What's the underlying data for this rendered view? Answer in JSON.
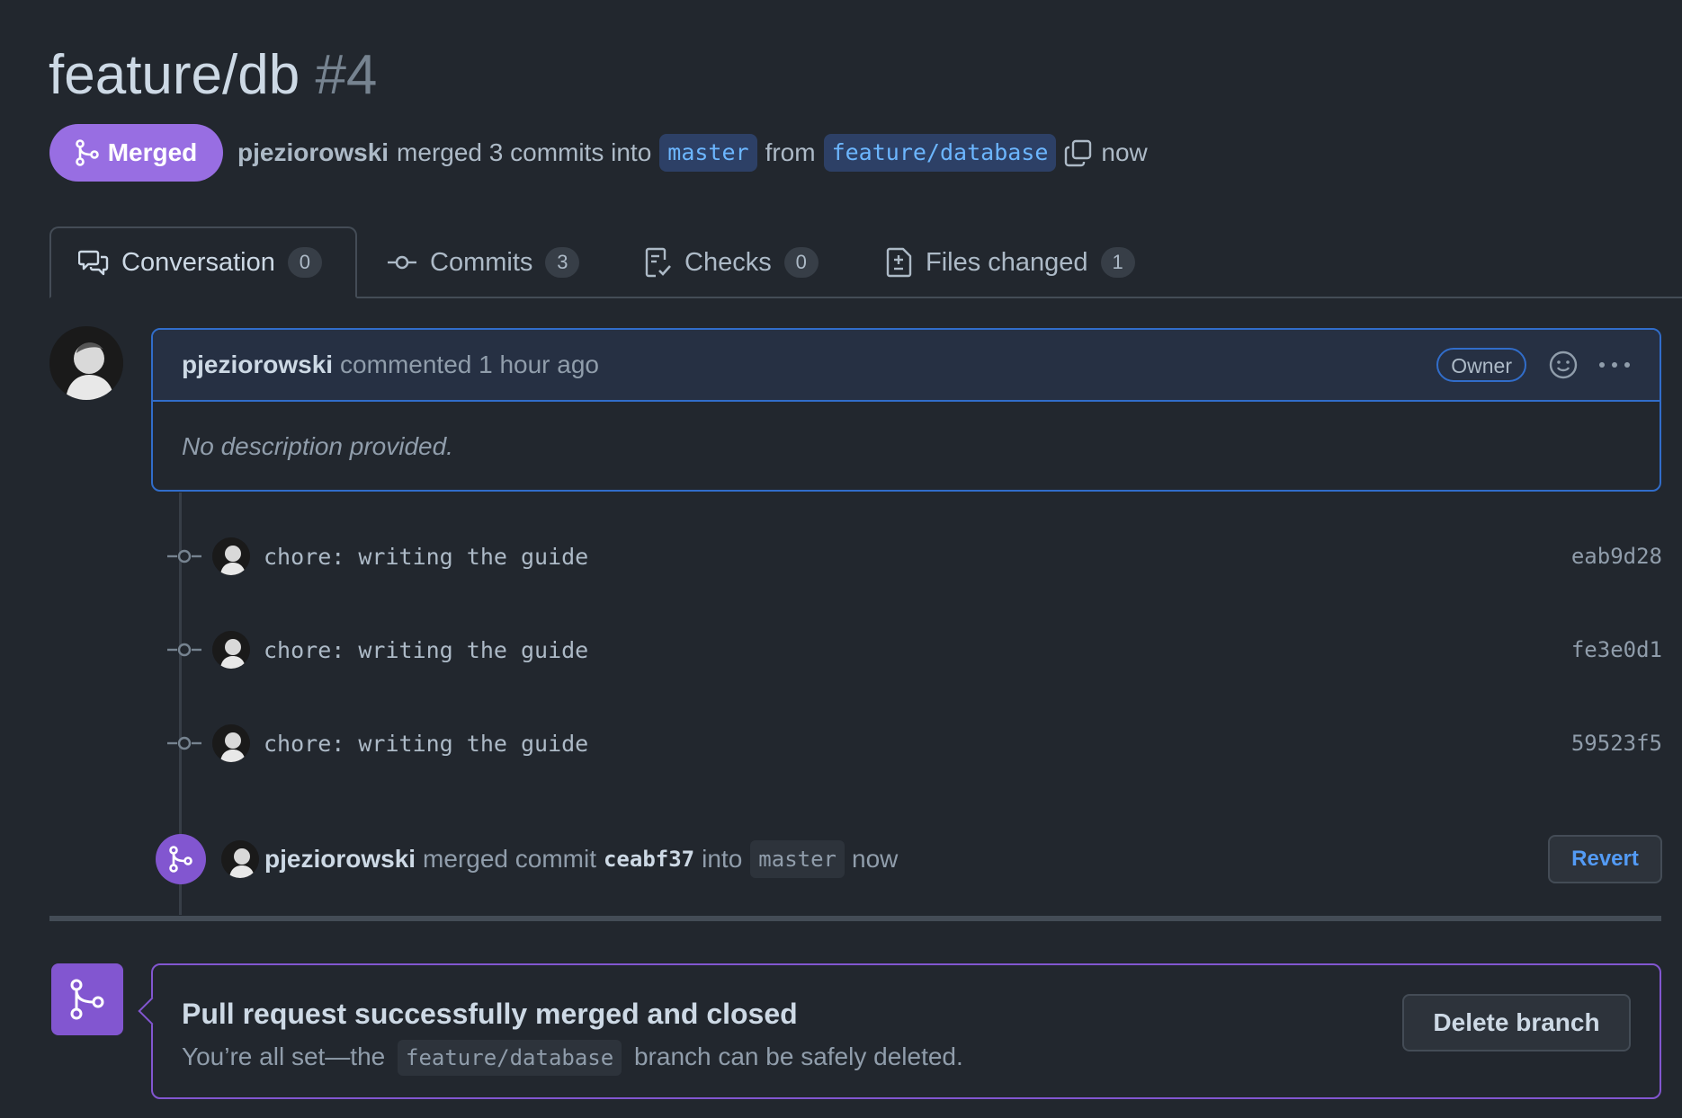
{
  "pr": {
    "title": "feature/db",
    "number": "#4",
    "state_label": "Merged",
    "author": "pjeziorowski",
    "merge_text": "merged 3 commits into",
    "base_branch": "master",
    "from_text": "from",
    "head_branch": "feature/database",
    "time": "now"
  },
  "tabs": [
    {
      "label": "Conversation",
      "count": "0",
      "icon": "comment-discussion-icon"
    },
    {
      "label": "Commits",
      "count": "3",
      "icon": "git-commit-icon"
    },
    {
      "label": "Checks",
      "count": "0",
      "icon": "checklist-icon"
    },
    {
      "label": "Files changed",
      "count": "1",
      "icon": "file-diff-icon"
    }
  ],
  "comment": {
    "author": "pjeziorowski",
    "meta": "commented 1 hour ago",
    "role": "Owner",
    "body": "No description provided."
  },
  "commits": [
    {
      "message": "chore: writing the guide",
      "sha": "eab9d28"
    },
    {
      "message": "chore: writing the guide",
      "sha": "fe3e0d1"
    },
    {
      "message": "chore: writing the guide",
      "sha": "59523f5"
    }
  ],
  "merge_event": {
    "author": "pjeziorowski",
    "text1": "merged commit",
    "sha": "ceabf37",
    "text2": "into",
    "branch": "master",
    "time": "now",
    "revert_label": "Revert"
  },
  "merged_box": {
    "title": "Pull request successfully merged and closed",
    "sub_before": "You’re all set—the",
    "branch": "feature/database",
    "sub_after": "branch can be safely deleted.",
    "delete_label": "Delete branch"
  },
  "colors": {
    "background": "#22272e",
    "merged_purple": "#8256d0",
    "accent_blue": "#316dca",
    "link_blue": "#539bf5"
  }
}
